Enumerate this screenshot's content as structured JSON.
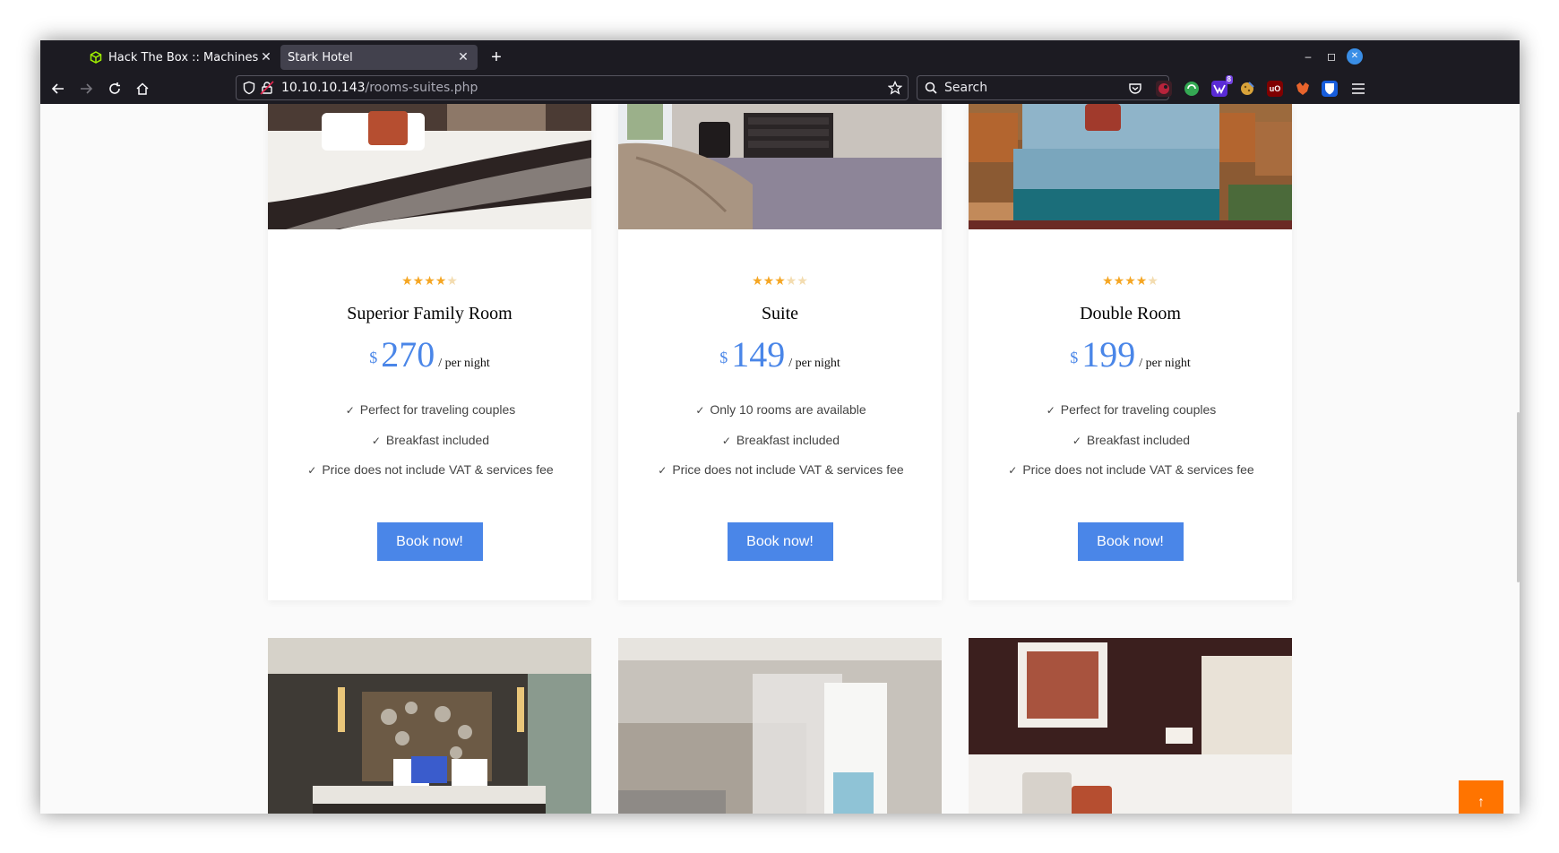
{
  "browser": {
    "tabs": [
      {
        "title": "Hack The Box :: Machines",
        "close": "✕",
        "icon": "htb-cube-icon"
      },
      {
        "title": "Stark Hotel",
        "close": "✕",
        "icon": "none"
      }
    ],
    "new_tab": "+",
    "url": {
      "host": "10.10.10.143",
      "path": "/rooms-suites.php"
    },
    "search_placeholder": "Search",
    "extension_badge": "8",
    "extension_ub_text": "uO",
    "window_controls": [
      "–",
      "◻",
      "✕"
    ]
  },
  "rooms": [
    {
      "name": "Superior Family Room",
      "stars_filled": 4,
      "stars_total": 5,
      "currency": "$",
      "price": "270",
      "per": "/ per night",
      "features": [
        "Perfect for traveling couples",
        "Breakfast included",
        "Price does not include VAT & services fee"
      ],
      "button": "Book now!"
    },
    {
      "name": "Suite",
      "stars_filled": 3,
      "stars_total": 5,
      "currency": "$",
      "price": "149",
      "per": "/ per night",
      "features": [
        "Only 10 rooms are available",
        "Breakfast included",
        "Price does not include VAT & services fee"
      ],
      "button": "Book now!"
    },
    {
      "name": "Double Room",
      "stars_filled": 4,
      "stars_total": 5,
      "currency": "$",
      "price": "199",
      "per": "/ per night",
      "features": [
        "Perfect for traveling couples",
        "Breakfast included",
        "Price does not include VAT & services fee"
      ],
      "button": "Book now!"
    }
  ],
  "colors": {
    "accent": "#4a86e8",
    "back_to_top": "#ff7400",
    "star": "#f5a623",
    "chrome": "#1c1b22"
  },
  "back_to_top_icon": "↑"
}
